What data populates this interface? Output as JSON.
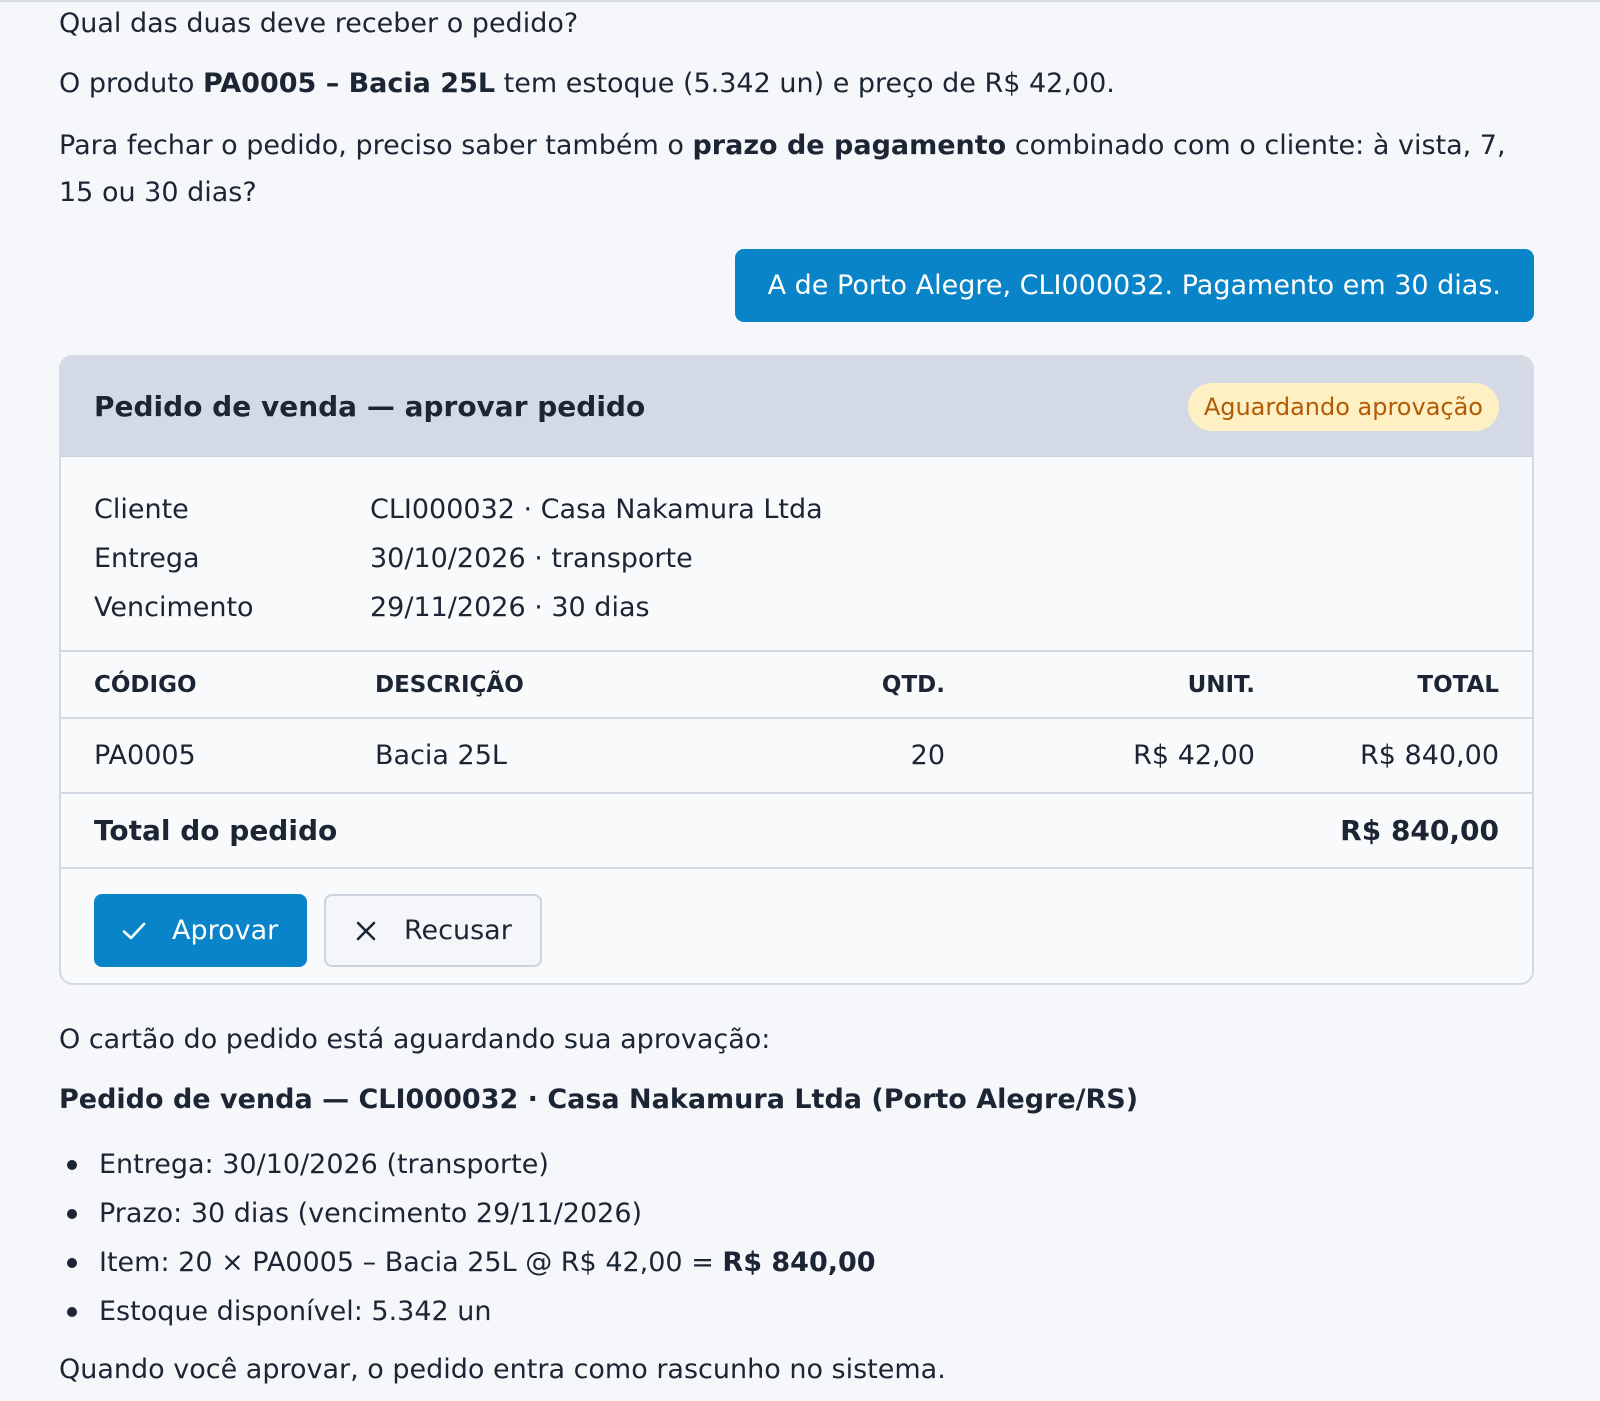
{
  "assistant_msg": {
    "q1": "Qual das duas deve receber o pedido?",
    "p2_pre": "O produto ",
    "p2_bold": "PA0005 – Bacia 25L",
    "p2_post": " tem estoque (5.342 un) e preço de R$ 42,00.",
    "p3_pre": "Para fechar o pedido, preciso saber também o ",
    "p3_bold": "prazo de pagamento",
    "p3_post": " combinado com o cliente: à vista, 7, 15 ou 30 dias?"
  },
  "user_msg": "A de Porto Alegre, CLI000032. Pagamento em 30 dias.",
  "card": {
    "title": "Pedido de venda — aprovar pedido",
    "status": "Aguardando aprovação",
    "meta": [
      {
        "label": "Cliente",
        "value": "CLI000032 · Casa Nakamura Ltda"
      },
      {
        "label": "Entrega",
        "value": "30/10/2026 · transporte"
      },
      {
        "label": "Vencimento",
        "value": "29/11/2026 · 30 dias"
      }
    ],
    "columns": {
      "code": "CÓDIGO",
      "desc": "DESCRIÇÃO",
      "qty": "QTD.",
      "unit": "UNIT.",
      "total": "TOTAL"
    },
    "rows": [
      {
        "code": "PA0005",
        "desc": "Bacia 25L",
        "qty": "20",
        "unit": "R$ 42,00",
        "total": "R$ 840,00"
      }
    ],
    "order_total_label": "Total do pedido",
    "order_total_value": "R$ 840,00",
    "approve_label": "Aprovar",
    "reject_label": "Recusar"
  },
  "summary": {
    "intro": "O cartão do pedido está aguardando sua aprovação:",
    "heading": "Pedido de venda — CLI000032 · Casa Nakamura Ltda (Porto Alegre/RS)",
    "b1": "Entrega: 30/10/2026 (transporte)",
    "b2": "Prazo: 30 dias (vencimento 29/11/2026)",
    "b3_pre": "Item: 20 × PA0005 – Bacia 25L @ R$ 42,00 = ",
    "b3_bold": "R$ 840,00",
    "b4": "Estoque disponível: 5.342 un",
    "closing": "Quando você aprovar, o pedido entra como rascunho no sistema."
  },
  "colors": {
    "accent": "#0a84c8",
    "badge_bg": "#fef0c2",
    "badge_text": "#b25b06"
  },
  "icons": {
    "approve": "check-icon",
    "reject": "close-icon"
  }
}
